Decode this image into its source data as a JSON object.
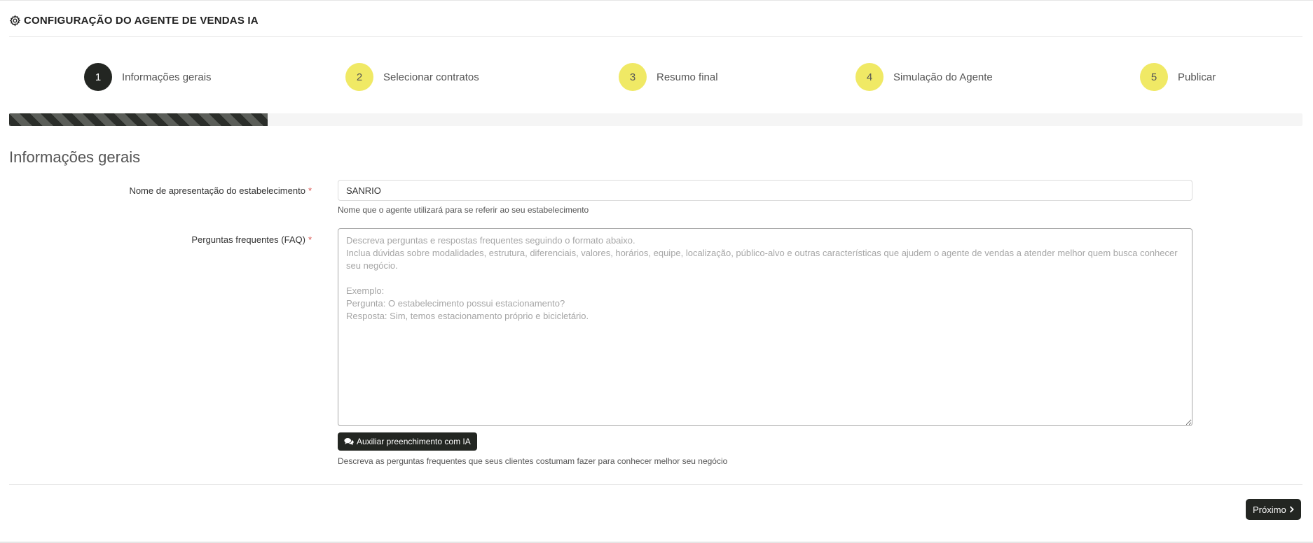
{
  "header": {
    "title": "CONFIGURAÇÃO DO AGENTE DE VENDAS IA",
    "icon": "gear-icon"
  },
  "steps": [
    {
      "number": "1",
      "label": "Informações gerais",
      "active": true
    },
    {
      "number": "2",
      "label": "Selecionar contratos",
      "active": false
    },
    {
      "number": "3",
      "label": "Resumo final",
      "active": false
    },
    {
      "number": "4",
      "label": "Simulação do Agente",
      "active": false
    },
    {
      "number": "5",
      "label": "Publicar",
      "active": false
    }
  ],
  "progress": {
    "percent": 20
  },
  "section": {
    "title": "Informações gerais"
  },
  "form": {
    "name_field": {
      "label": "Nome de apresentação do estabelecimento",
      "required_mark": "*",
      "value": "SANRIO",
      "help": "Nome que o agente utilizará para se referir ao seu estabelecimento"
    },
    "faq_field": {
      "label": "Perguntas frequentes (FAQ)",
      "required_mark": "*",
      "value": "",
      "placeholder": "Descreva perguntas e respostas frequentes seguindo o formato abaixo.\nInclua dúvidas sobre modalidades, estrutura, diferenciais, valores, horários, equipe, localização, público-alvo e outras características que ajudem o agente de vendas a atender melhor quem busca conhecer seu negócio.\n\nExemplo:\nPergunta: O estabelecimento possui estacionamento?\nResposta: Sim, temos estacionamento próprio e bicicletário.",
      "ai_button": "Auxiliar preenchimento com IA",
      "ai_icon": "chat-icon",
      "help": "Descreva as perguntas frequentes que seus clientes costumam fazer para conhecer melhor seu negócio"
    }
  },
  "footer": {
    "next_label": "Próximo",
    "next_icon": "chevron-right-icon"
  },
  "colors": {
    "step_pending": "#f0e965",
    "step_active": "#232622",
    "button_bg": "#232622",
    "required": "#d9534f"
  }
}
